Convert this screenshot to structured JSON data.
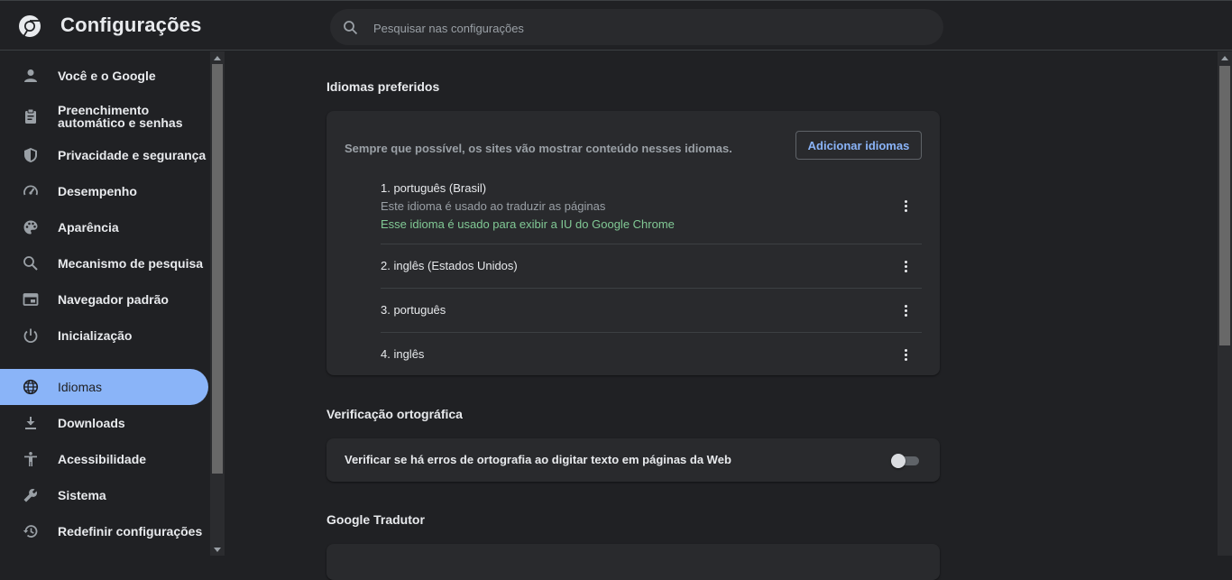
{
  "header": {
    "title": "Configurações",
    "search_placeholder": "Pesquisar nas configurações",
    "search_value": ""
  },
  "sidebar": {
    "items": [
      {
        "label": "Você e o Google",
        "icon": "person-icon"
      },
      {
        "label_line1": "Preenchimento",
        "label_line2": "automático e senhas",
        "icon": "clipboard-icon"
      },
      {
        "label": "Privacidade e segurança",
        "icon": "shield-icon"
      },
      {
        "label": "Desempenho",
        "icon": "speedometer-icon"
      },
      {
        "label": "Aparência",
        "icon": "palette-icon"
      },
      {
        "label": "Mecanismo de pesquisa",
        "icon": "search-icon"
      },
      {
        "label": "Navegador padrão",
        "icon": "browser-icon"
      },
      {
        "label": "Inicialização",
        "icon": "power-icon"
      },
      {
        "label": "Idiomas",
        "icon": "globe-icon",
        "active": true
      },
      {
        "label": "Downloads",
        "icon": "download-icon"
      },
      {
        "label": "Acessibilidade",
        "icon": "accessibility-icon"
      },
      {
        "label": "Sistema",
        "icon": "wrench-icon"
      },
      {
        "label": "Redefinir configurações",
        "icon": "history-icon"
      }
    ]
  },
  "languages": {
    "title": "Idiomas preferidos",
    "description": "Sempre que possível, os sites vão mostrar conteúdo nesses idiomas.",
    "add_button": "Adicionar idiomas",
    "items": [
      {
        "name": "1. português (Brasil)",
        "sub": "Este idioma é usado ao traduzir as páginas",
        "note": "Esse idioma é usado para exibir a IU do Google Chrome"
      },
      {
        "name": "2. inglês (Estados Unidos)"
      },
      {
        "name": "3. português"
      },
      {
        "name": "4. inglês"
      }
    ]
  },
  "spellcheck": {
    "title": "Verificação ortográfica",
    "label": "Verificar se há erros de ortografia ao digitar texto em páginas da Web",
    "enabled": false
  },
  "translate": {
    "title": "Google Tradutor"
  },
  "colors": {
    "background": "#202124",
    "card": "#292a2d",
    "accent": "#8ab4f8",
    "note_green": "#81c995"
  }
}
